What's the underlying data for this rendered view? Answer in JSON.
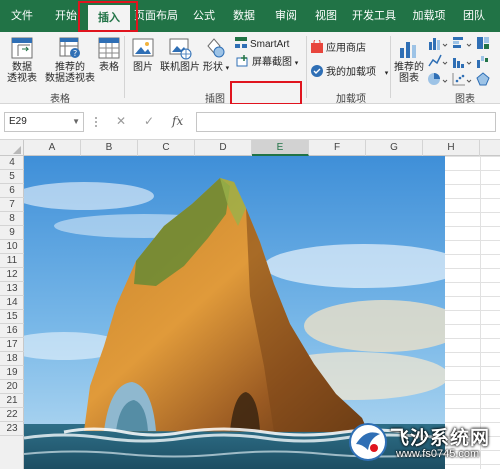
{
  "tabs": [
    {
      "label": "文件"
    },
    {
      "label": "开始"
    },
    {
      "label": "插入"
    },
    {
      "label": "页面布局"
    },
    {
      "label": "公式"
    },
    {
      "label": "数据"
    },
    {
      "label": "审阅"
    },
    {
      "label": "视图"
    },
    {
      "label": "开发工具"
    },
    {
      "label": "加载项"
    },
    {
      "label": "团队"
    }
  ],
  "active_tab": "插入",
  "ribbon": {
    "tables": {
      "label": "表格",
      "pivot": {
        "line1": "数据",
        "line2": "透视表"
      },
      "rec_pivot": {
        "line1": "推荐的",
        "line2": "数据透视表"
      },
      "table": {
        "line1": "表格"
      }
    },
    "illustrations": {
      "label": "插图",
      "picture": "图片",
      "online_picture": "联机图片",
      "shapes": "形状",
      "smartart": "SmartArt",
      "screenshot": "屏幕截图"
    },
    "addins": {
      "label": "加载项",
      "store": "应用商店",
      "my_addins": "我的加载项"
    },
    "charts": {
      "label": "图表",
      "recommended": {
        "line1": "推荐的",
        "line2": "图表"
      }
    }
  },
  "formula_bar": {
    "name_box": "E29",
    "cancel_glyph": "✕",
    "enter_glyph": "✓",
    "fx_glyph": "fx",
    "formula": ""
  },
  "columns": [
    "A",
    "B",
    "C",
    "D",
    "E",
    "F",
    "G",
    "H"
  ],
  "selected_column": "E",
  "rows": [
    "4",
    "5",
    "6",
    "7",
    "8",
    "9",
    "10",
    "11",
    "12",
    "13",
    "14",
    "15",
    "16",
    "17",
    "18",
    "19",
    "20",
    "21",
    "22",
    "23"
  ],
  "watermark": {
    "text": "飞沙系统网",
    "url": "www.fs0745.com"
  },
  "colors": {
    "excel_green": "#217346",
    "highlight_red": "#e0141e",
    "ribbon_bg": "#f3f3f3"
  }
}
